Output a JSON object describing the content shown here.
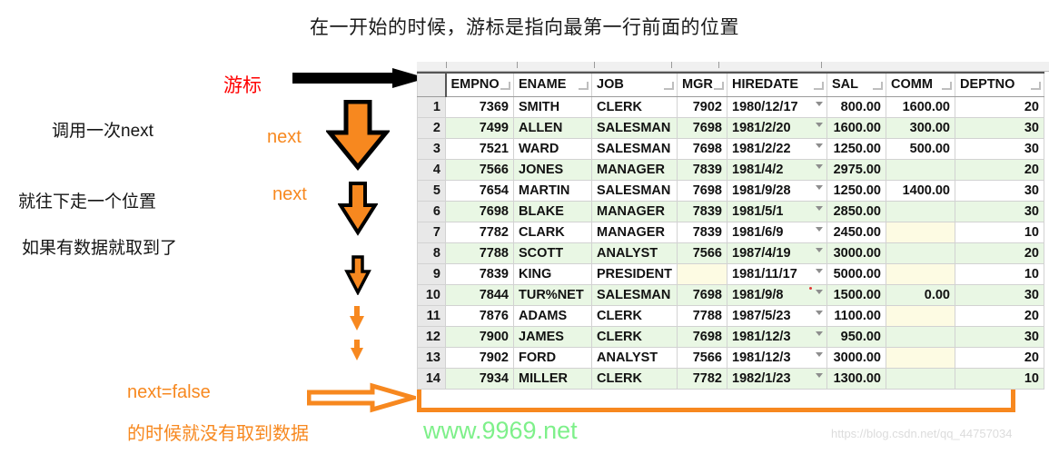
{
  "title": "在一开始的时候，游标是指向最第一行前面的位置",
  "annotations": {
    "cursor_label": "游标",
    "call_next": "调用一次next",
    "move_down": "就往下走一个位置",
    "has_data": "如果有数据就取到了",
    "next_label_1": "next",
    "next_label_2": "next",
    "next_false": "next=false",
    "no_data": "的时候就没有取到数据"
  },
  "watermarks": {
    "green": "www.9969.net",
    "gray": "https://blog.csdn.net/qq_44757034"
  },
  "colors": {
    "orange": "#f7881f",
    "red": "#ff0000",
    "row_green": "#e9f7e4",
    "null_cream": "#fdfbe3",
    "watermark_green": "#7ef08a"
  },
  "table": {
    "columns": [
      "EMPNO",
      "ENAME",
      "JOB",
      "MGR",
      "HIREDATE",
      "SAL",
      "COMM",
      "DEPTNO"
    ],
    "rows": [
      {
        "n": "1",
        "EMPNO": "7369",
        "ENAME": "SMITH",
        "JOB": "CLERK",
        "MGR": "7902",
        "HIREDATE": "1980/12/17",
        "SAL": "800.00",
        "COMM": "1600.00",
        "DEPTNO": "20"
      },
      {
        "n": "2",
        "EMPNO": "7499",
        "ENAME": "ALLEN",
        "JOB": "SALESMAN",
        "MGR": "7698",
        "HIREDATE": "1981/2/20",
        "SAL": "1600.00",
        "COMM": "300.00",
        "DEPTNO": "30"
      },
      {
        "n": "3",
        "EMPNO": "7521",
        "ENAME": "WARD",
        "JOB": "SALESMAN",
        "MGR": "7698",
        "HIREDATE": "1981/2/22",
        "SAL": "1250.00",
        "COMM": "500.00",
        "DEPTNO": "30"
      },
      {
        "n": "4",
        "EMPNO": "7566",
        "ENAME": "JONES",
        "JOB": "MANAGER",
        "MGR": "7839",
        "HIREDATE": "1981/4/2",
        "SAL": "2975.00",
        "COMM": "",
        "DEPTNO": "20"
      },
      {
        "n": "5",
        "EMPNO": "7654",
        "ENAME": "MARTIN",
        "JOB": "SALESMAN",
        "MGR": "7698",
        "HIREDATE": "1981/9/28",
        "SAL": "1250.00",
        "COMM": "1400.00",
        "DEPTNO": "30"
      },
      {
        "n": "6",
        "EMPNO": "7698",
        "ENAME": "BLAKE",
        "JOB": "MANAGER",
        "MGR": "7839",
        "HIREDATE": "1981/5/1",
        "SAL": "2850.00",
        "COMM": "",
        "DEPTNO": "30"
      },
      {
        "n": "7",
        "EMPNO": "7782",
        "ENAME": "CLARK",
        "JOB": "MANAGER",
        "MGR": "7839",
        "HIREDATE": "1981/6/9",
        "SAL": "2450.00",
        "COMM": "",
        "DEPTNO": "10"
      },
      {
        "n": "8",
        "EMPNO": "7788",
        "ENAME": "SCOTT",
        "JOB": "ANALYST",
        "MGR": "7566",
        "HIREDATE": "1987/4/19",
        "SAL": "3000.00",
        "COMM": "",
        "DEPTNO": "20"
      },
      {
        "n": "9",
        "EMPNO": "7839",
        "ENAME": "KING",
        "JOB": "PRESIDENT",
        "MGR": "",
        "HIREDATE": "1981/11/17",
        "SAL": "5000.00",
        "COMM": "",
        "DEPTNO": "10"
      },
      {
        "n": "10",
        "EMPNO": "7844",
        "ENAME": "TUR%NET",
        "JOB": "SALESMAN",
        "MGR": "7698",
        "HIREDATE": "1981/9/8",
        "SAL": "1500.00",
        "COMM": "0.00",
        "DEPTNO": "30"
      },
      {
        "n": "11",
        "EMPNO": "7876",
        "ENAME": "ADAMS",
        "JOB": "CLERK",
        "MGR": "7788",
        "HIREDATE": "1987/5/23",
        "SAL": "1100.00",
        "COMM": "",
        "DEPTNO": "20"
      },
      {
        "n": "12",
        "EMPNO": "7900",
        "ENAME": "JAMES",
        "JOB": "CLERK",
        "MGR": "7698",
        "HIREDATE": "1981/12/3",
        "SAL": "950.00",
        "COMM": "",
        "DEPTNO": "30"
      },
      {
        "n": "13",
        "EMPNO": "7902",
        "ENAME": "FORD",
        "JOB": "ANALYST",
        "MGR": "7566",
        "HIREDATE": "1981/12/3",
        "SAL": "3000.00",
        "COMM": "",
        "DEPTNO": "20"
      },
      {
        "n": "14",
        "EMPNO": "7934",
        "ENAME": "MILLER",
        "JOB": "CLERK",
        "MGR": "7782",
        "HIREDATE": "1982/1/23",
        "SAL": "1300.00",
        "COMM": "",
        "DEPTNO": "10"
      }
    ]
  }
}
